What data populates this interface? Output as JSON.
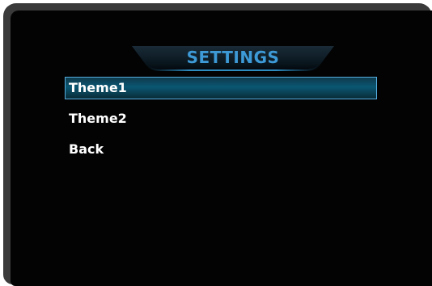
{
  "screen": {
    "title": "SETTINGS"
  },
  "menu": {
    "items": [
      {
        "label": "Theme1",
        "selected": true
      },
      {
        "label": "Theme2",
        "selected": false
      },
      {
        "label": "Back",
        "selected": false
      }
    ]
  },
  "colors": {
    "background": "#030303",
    "title": "#3d9ad6",
    "highlight_border": "#55aee0",
    "highlight_fill": "#0a5672",
    "text": "#ffffff"
  }
}
